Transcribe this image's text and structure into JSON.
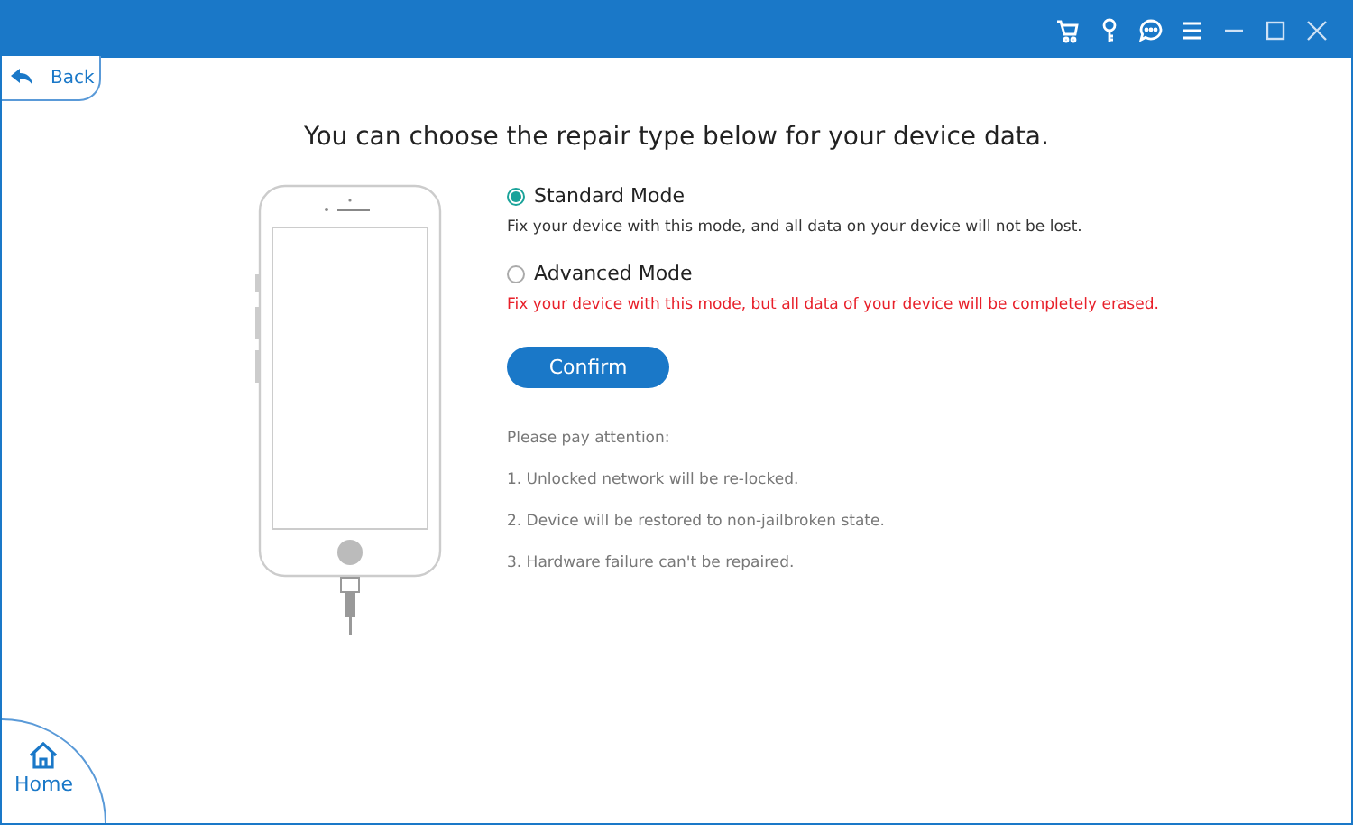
{
  "back_button": {
    "label": "Back"
  },
  "heading": "You can choose the repair type below for your device data.",
  "modes": [
    {
      "label": "Standard Mode",
      "selected": true,
      "description": "Fix your device with this mode, and all data on your device will not be lost.",
      "warning": false
    },
    {
      "label": "Advanced Mode",
      "selected": false,
      "description": "Fix your device with this mode, but all data of your device will be completely erased.",
      "warning": true
    }
  ],
  "confirm_button": "Confirm",
  "notes_title": "Please pay attention:",
  "notes": [
    "1. Unlocked network will be re-locked.",
    "2. Device will be restored to non-jailbroken state.",
    "3. Hardware failure can't be repaired."
  ],
  "home_button": {
    "label": "Home"
  }
}
